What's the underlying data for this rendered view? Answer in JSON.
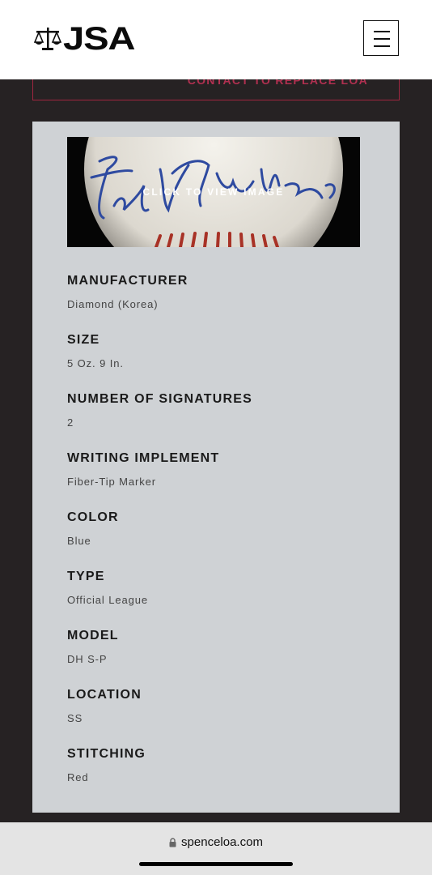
{
  "header": {
    "logo_text": "JSA",
    "menu_icon": "hamburger-icon"
  },
  "contact": {
    "label": "CONTACT TO REPLACE LOA"
  },
  "image_banner": {
    "label": "CLICK TO VIEW IMAGE"
  },
  "details": [
    {
      "label": "MANUFACTURER",
      "value": "Diamond (Korea)"
    },
    {
      "label": "SIZE",
      "value": "5 Oz. 9 In."
    },
    {
      "label": "NUMBER OF SIGNATURES",
      "value": "2"
    },
    {
      "label": "WRITING IMPLEMENT",
      "value": "Fiber-Tip Marker"
    },
    {
      "label": "COLOR",
      "value": "Blue"
    },
    {
      "label": "TYPE",
      "value": "Official League"
    },
    {
      "label": "MODEL",
      "value": "DH S-P"
    },
    {
      "label": "LOCATION",
      "value": "SS"
    },
    {
      "label": "STITCHING",
      "value": "Red"
    }
  ],
  "browser": {
    "url": "spenceloa.com",
    "lock_icon": "lock-icon"
  },
  "colors": {
    "header_bg": "#ffffff",
    "page_bg": "#262223",
    "card_bg": "#cfd2d5",
    "accent": "#b03050"
  }
}
